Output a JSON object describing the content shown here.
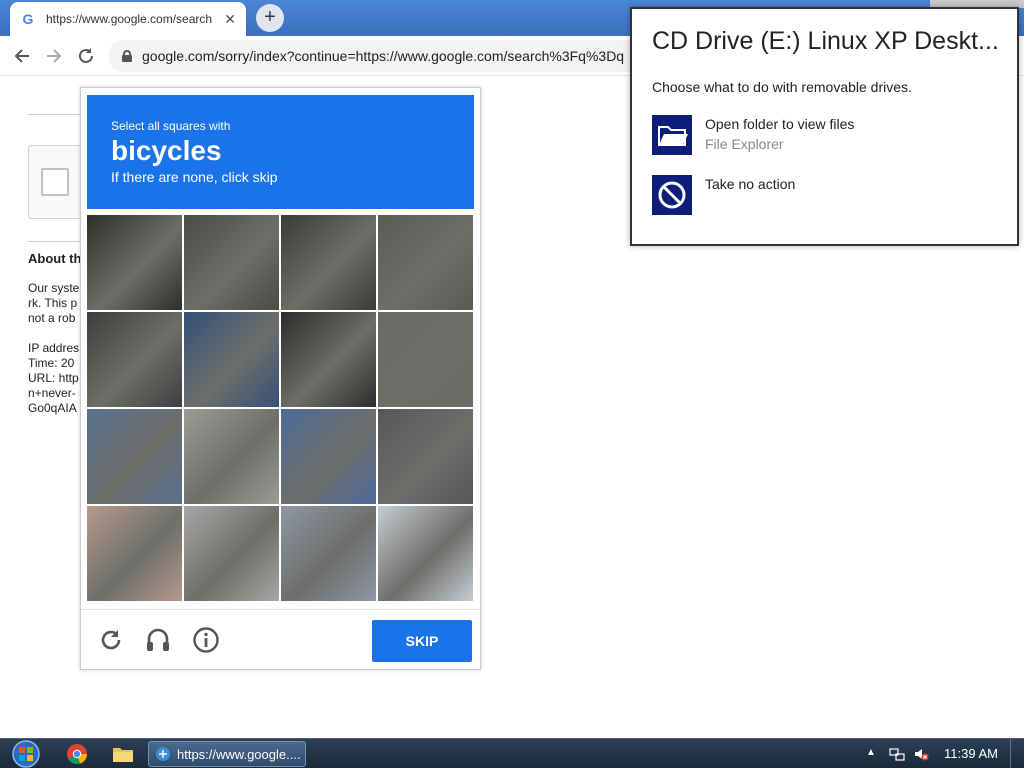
{
  "browser": {
    "tab_title": "https://www.google.com/search",
    "tab_favicon": "G",
    "new_tab_symbol": "+",
    "close_symbol": "✕",
    "url": "google.com/sorry/index?continue=https://www.google.com/search%3Fq%3Dq"
  },
  "page": {
    "about_heading": "About th",
    "paragraph_lines": [
      "Our syste",
      "rk. This p",
      "not a rob"
    ],
    "info_lines": [
      "IP addres",
      "Time: 20",
      "URL: http",
      "n+never-",
      "Go0qAIA"
    ]
  },
  "captcha": {
    "instruction": "Select all squares with",
    "target": "bicycles",
    "hint": "If there are none, click skip",
    "skip_label": "SKIP",
    "grid_size": 4
  },
  "autoplay": {
    "title": "CD Drive (E:) Linux XP Deskt...",
    "subtitle": "Choose what to do with removable drives.",
    "option1_label": "Open folder to view files",
    "option1_sub": "File Explorer",
    "option2_label": "Take no action"
  },
  "taskbar": {
    "task_label": "https://www.google....",
    "clock": "11:39 AM"
  },
  "colors": {
    "captcha_blue": "#1a73e8",
    "autoplay_icon_bg": "#0e1d7a"
  }
}
